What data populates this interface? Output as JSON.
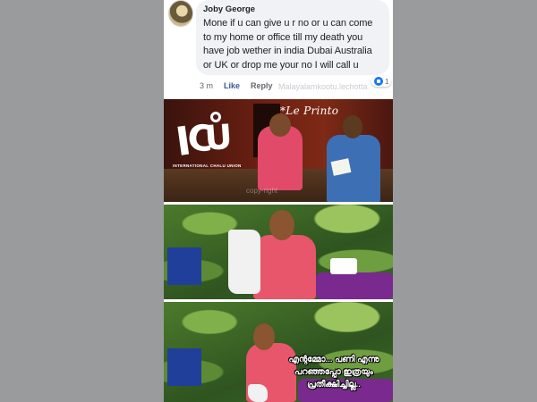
{
  "comment": {
    "author": "Joby George",
    "text": "Mone if u can give u r no or u can come to my home or office till my death you have job wether in india Dubai Australia or UK or drop me your no I will call u",
    "time": "3 m",
    "like_label": "Like",
    "reply_label": "Reply",
    "watermark": "Malayalamkootu.lechotta",
    "reaction_count": "1",
    "reaction_icon": "like-icon"
  },
  "frames": {
    "frame1": {
      "logo_text": "INTERNATIONAL CHALU UNION",
      "brand": "*Le Printo",
      "watermark": "copy-right"
    },
    "frame3": {
      "subtitle_line1": "എന്റമ്മോ... പണി എന്നു",
      "subtitle_line2": "പറഞ്ഞപ്പോ ഇത്രയും",
      "subtitle_line3": "പ്രതീക്ഷിച്ചില്ല.."
    }
  },
  "colors": {
    "like_blue": "#385898",
    "bubble_bg": "#f0f2f5",
    "page_grey": "#9a9b9d"
  }
}
